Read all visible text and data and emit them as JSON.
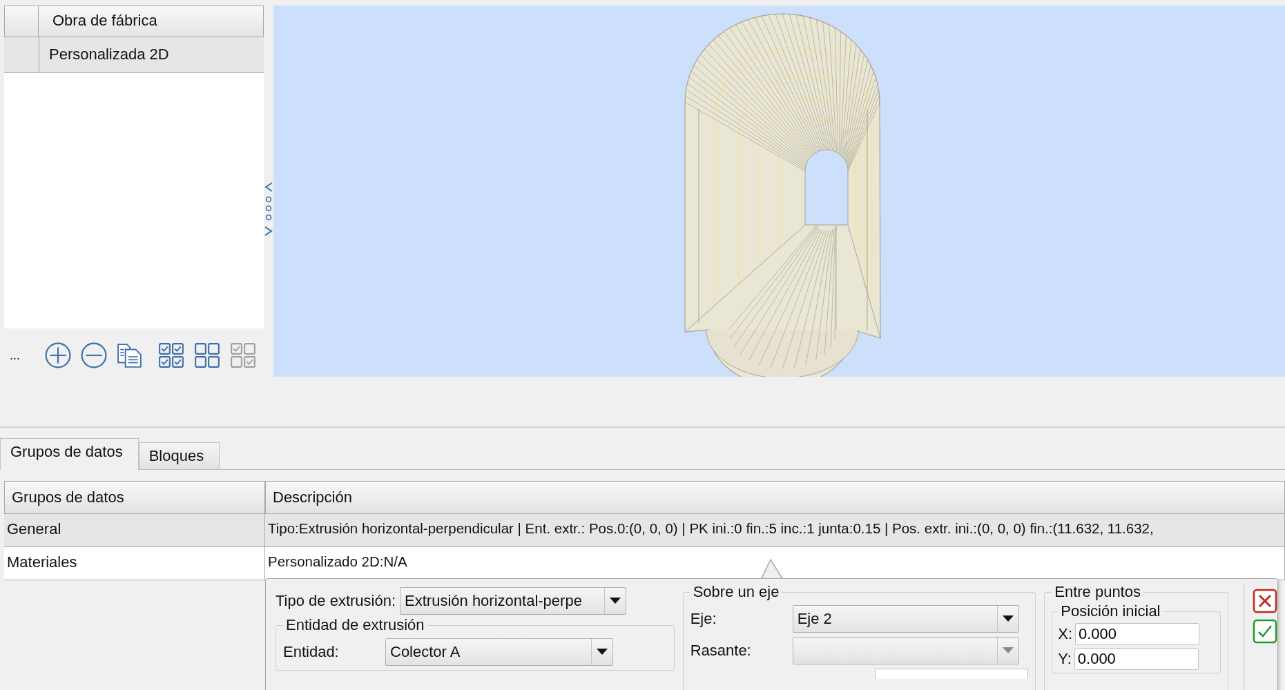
{
  "left_panel": {
    "header": {
      "title": "Obra de fábrica"
    },
    "rows": [
      {
        "label": "Personalizada 2D",
        "selected": true
      }
    ],
    "toolbar": {
      "more": "..."
    }
  },
  "tabs": [
    {
      "label": "Grupos de datos",
      "selected": true
    },
    {
      "label": "Bloques",
      "selected": false
    }
  ],
  "table": {
    "columns": [
      "Grupos de datos",
      "Descripción"
    ],
    "rows": [
      {
        "group": "General",
        "description": "Tipo:Extrusión horizontal-perpendicular | Ent. extr.: Pos.0:(0, 0, 0) | PK ini.:0 fin.:5 inc.:1 junta:0.15 | Pos. extr. ini.:(0, 0, 0) fin.:(11.632, 11.632,",
        "selected": true
      },
      {
        "group": "Materiales",
        "description": "Personalizado 2D:N/A",
        "selected": false
      }
    ]
  },
  "popup": {
    "extrusion_type": {
      "label": "Tipo de extrusión:",
      "value": "Extrusión horizontal-perpe",
      "disabled": false
    },
    "extrusion_entity": {
      "title": "Entidad de extrusión",
      "entity": {
        "label": "Entidad:",
        "value": "Colector A",
        "disabled": false
      }
    },
    "on_axis": {
      "title": "Sobre un eje",
      "axis": {
        "label": "Eje:",
        "value": "Eje 2",
        "disabled": false
      },
      "grade": {
        "label": "Rasante:",
        "disabled": true
      }
    },
    "between_points": {
      "title": "Entre puntos",
      "initial_position": {
        "title": "Posición inicial",
        "x": {
          "label": "X:",
          "value": "0.000"
        },
        "y": {
          "label": "Y:",
          "value": "0.000"
        }
      }
    }
  }
}
